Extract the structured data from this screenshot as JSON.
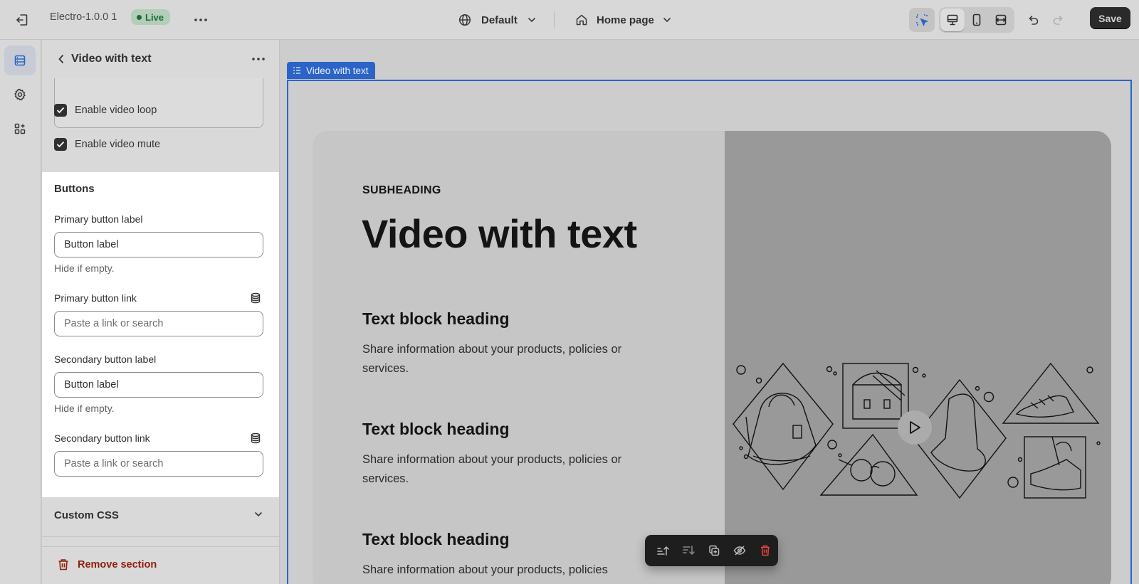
{
  "topbar": {
    "theme_name": "Electro-1.0.0 1",
    "status_badge": "Live",
    "locale": "Default",
    "page": "Home page",
    "save_label": "Save"
  },
  "panel": {
    "title": "Video with text",
    "checkboxes": [
      {
        "label": "Enable video loop",
        "checked": true
      },
      {
        "label": "Enable video mute",
        "checked": true
      }
    ],
    "buttons_section": {
      "title": "Buttons",
      "primary_label_label": "Primary button label",
      "primary_label_value": "Button label",
      "primary_label_help": "Hide if empty.",
      "primary_link_label": "Primary button link",
      "primary_link_placeholder": "Paste a link or search",
      "secondary_label_label": "Secondary button label",
      "secondary_label_value": "Button label",
      "secondary_label_help": "Hide if empty.",
      "secondary_link_label": "Secondary button link",
      "secondary_link_placeholder": "Paste a link or search"
    },
    "custom_css": "Custom CSS",
    "remove_section": "Remove section"
  },
  "preview": {
    "selected_tag": "Video with text",
    "subheading": "SUBHEADING",
    "heading": "Video with text",
    "blocks": [
      {
        "heading": "Text block heading",
        "text": "Share information about your products, policies or services."
      },
      {
        "heading": "Text block heading",
        "text": "Share information about your products, policies or services."
      },
      {
        "heading": "Text block heading",
        "text": "Share information about your products, policies"
      }
    ]
  },
  "colors": {
    "accent": "#2b64c6",
    "live_badge_bg": "#b3cdb8",
    "live_badge_text": "#1c6a38",
    "danger": "#8e1f0b",
    "save_button": "#2a2a2a"
  }
}
